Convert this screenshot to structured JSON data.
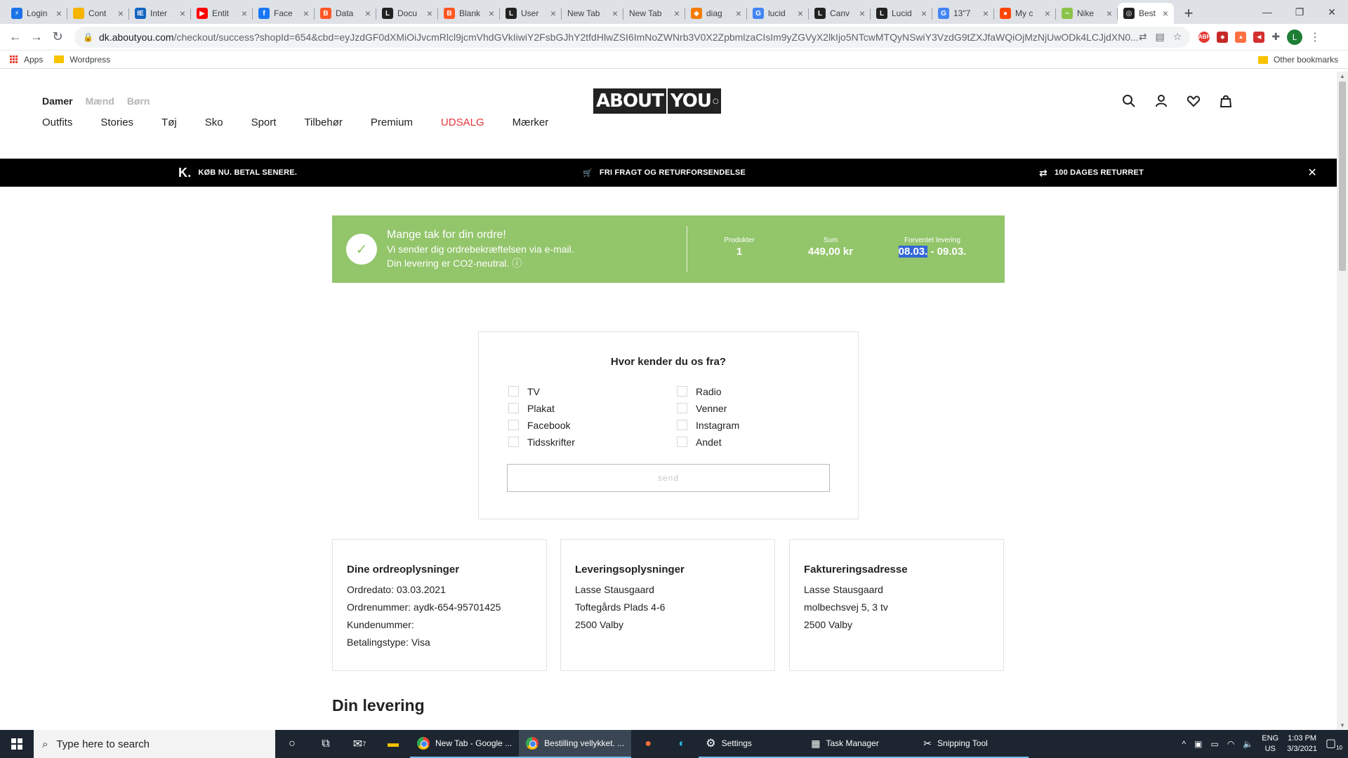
{
  "browser": {
    "tabs": [
      {
        "label": "Login",
        "fav_color": "#1a73e8",
        "fav_text": "⚡"
      },
      {
        "label": "Cont",
        "fav_color": "#f4b400",
        "fav_text": ""
      },
      {
        "label": "Inter",
        "fav_color": "#1565c0",
        "fav_text": "IE"
      },
      {
        "label": "Entit",
        "fav_color": "#ff0000",
        "fav_text": "▶"
      },
      {
        "label": "Face",
        "fav_color": "#1877f2",
        "fav_text": "f"
      },
      {
        "label": "Data",
        "fav_color": "#ff5722",
        "fav_text": "B"
      },
      {
        "label": "Docu",
        "fav_color": "#222222",
        "fav_text": "L"
      },
      {
        "label": "Blank",
        "fav_color": "#ff5722",
        "fav_text": "B"
      },
      {
        "label": "User",
        "fav_color": "#222222",
        "fav_text": "L"
      },
      {
        "label": "New Tab",
        "fav_color": "",
        "fav_text": ""
      },
      {
        "label": "New Tab",
        "fav_color": "",
        "fav_text": ""
      },
      {
        "label": "diag",
        "fav_color": "#f57c00",
        "fav_text": "◆"
      },
      {
        "label": "lucid",
        "fav_color": "#4285f4",
        "fav_text": "G"
      },
      {
        "label": "Canv",
        "fav_color": "#222222",
        "fav_text": "L"
      },
      {
        "label": "Lucid",
        "fav_color": "#222222",
        "fav_text": "L"
      },
      {
        "label": "13\"7",
        "fav_color": "#4285f4",
        "fav_text": "G"
      },
      {
        "label": "My c",
        "fav_color": "#ff4500",
        "fav_text": "●"
      },
      {
        "label": "Nike",
        "fav_color": "#8bc34a",
        "fav_text": "~"
      },
      {
        "label": "Best",
        "fav_color": "#222222",
        "fav_text": "◎"
      }
    ],
    "new_tab_symbol": "+",
    "window": {
      "minimize": "—",
      "restore": "❐",
      "close": "✕"
    },
    "nav": {
      "back": "←",
      "forward": "→",
      "reload": "↻"
    },
    "url_host": "dk.aboutyou.com",
    "url_path": "/checkout/success?shopId=654&cbd=eyJzdGF0dXMiOiJvcmRlcl9jcmVhdGVkIiwiY2FsbGJhY2tfdHlwZSI6ImNoZWNrb3V0X2ZpbmlzaCIsIm9yZGVyX2lkIjo5NTcwMTQyNSwiY3VzdG9tZXJfaWQiOjMzNjUwODk4LCJjdXN0...",
    "profile_initial": "L",
    "bookmarks": {
      "apps": "Apps",
      "wordpress": "Wordpress",
      "other": "Other bookmarks"
    }
  },
  "site": {
    "gender_tabs": [
      "Damer",
      "Mænd",
      "Børn"
    ],
    "logo": {
      "part1": "ABOUT",
      "part2": "YOU"
    },
    "categories": [
      "Outfits",
      "Stories",
      "Tøj",
      "Sko",
      "Sport",
      "Tilbehør",
      "Premium",
      "UDSALG",
      "Mærker"
    ],
    "promo": {
      "klarna_logo": "K.",
      "klarna": "KØB NU. BETAL SENERE.",
      "shipping": "FRI FRAGT OG RETURFORSENDELSE",
      "returns": "100 DAGES RETURRET"
    }
  },
  "order_success": {
    "title": "Mange tak for din ordre!",
    "line2": "Vi sender dig ordrebekræftelsen via e-mail.",
    "line3": "Din levering er CO2-neutral.",
    "products_label": "Produkter",
    "products_value": "1",
    "sum_label": "Sum",
    "sum_value": "449,00 kr",
    "delivery_label": "Forventet levering",
    "delivery_from": "08.03.",
    "delivery_to": " - 09.03."
  },
  "survey": {
    "title": "Hvor kender du os fra?",
    "options": [
      "TV",
      "Radio",
      "Plakat",
      "Venner",
      "Facebook",
      "Instagram",
      "Tidsskrifter",
      "Andet"
    ],
    "submit": "send"
  },
  "order_info": {
    "title": "Dine ordreoplysninger",
    "date": "Ordredato: 03.03.2021",
    "number": "Ordrenummer: aydk-654-95701425",
    "customer": "Kundenummer:",
    "payment": "Betalingstype: Visa"
  },
  "delivery_info": {
    "title": "Leveringsoplysninger",
    "name": "Lasse Stausgaard",
    "street": "Toftegårds Plads 4-6",
    "city": "2500 Valby"
  },
  "billing_info": {
    "title": "Faktureringsadresse",
    "name": "Lasse Stausgaard",
    "street": "molbechsvej 5, 3 tv",
    "city": "2500 Valby"
  },
  "delivery_section_title": "Din levering",
  "taskbar": {
    "search_placeholder": "Type here to search",
    "mail_badge": "7",
    "apps": [
      {
        "label": "New Tab - Google ..."
      },
      {
        "label": "Bestilling vellykket. ..."
      },
      {
        "label": "Settings"
      },
      {
        "label": "Task Manager"
      },
      {
        "label": "Snipping Tool"
      }
    ],
    "lang": "ENG",
    "region": "US",
    "time": "1:03 PM",
    "date": "3/3/2021",
    "notifications": "10"
  },
  "colors": {
    "success_green": "#93c56b",
    "sale_red": "#e3363c"
  }
}
